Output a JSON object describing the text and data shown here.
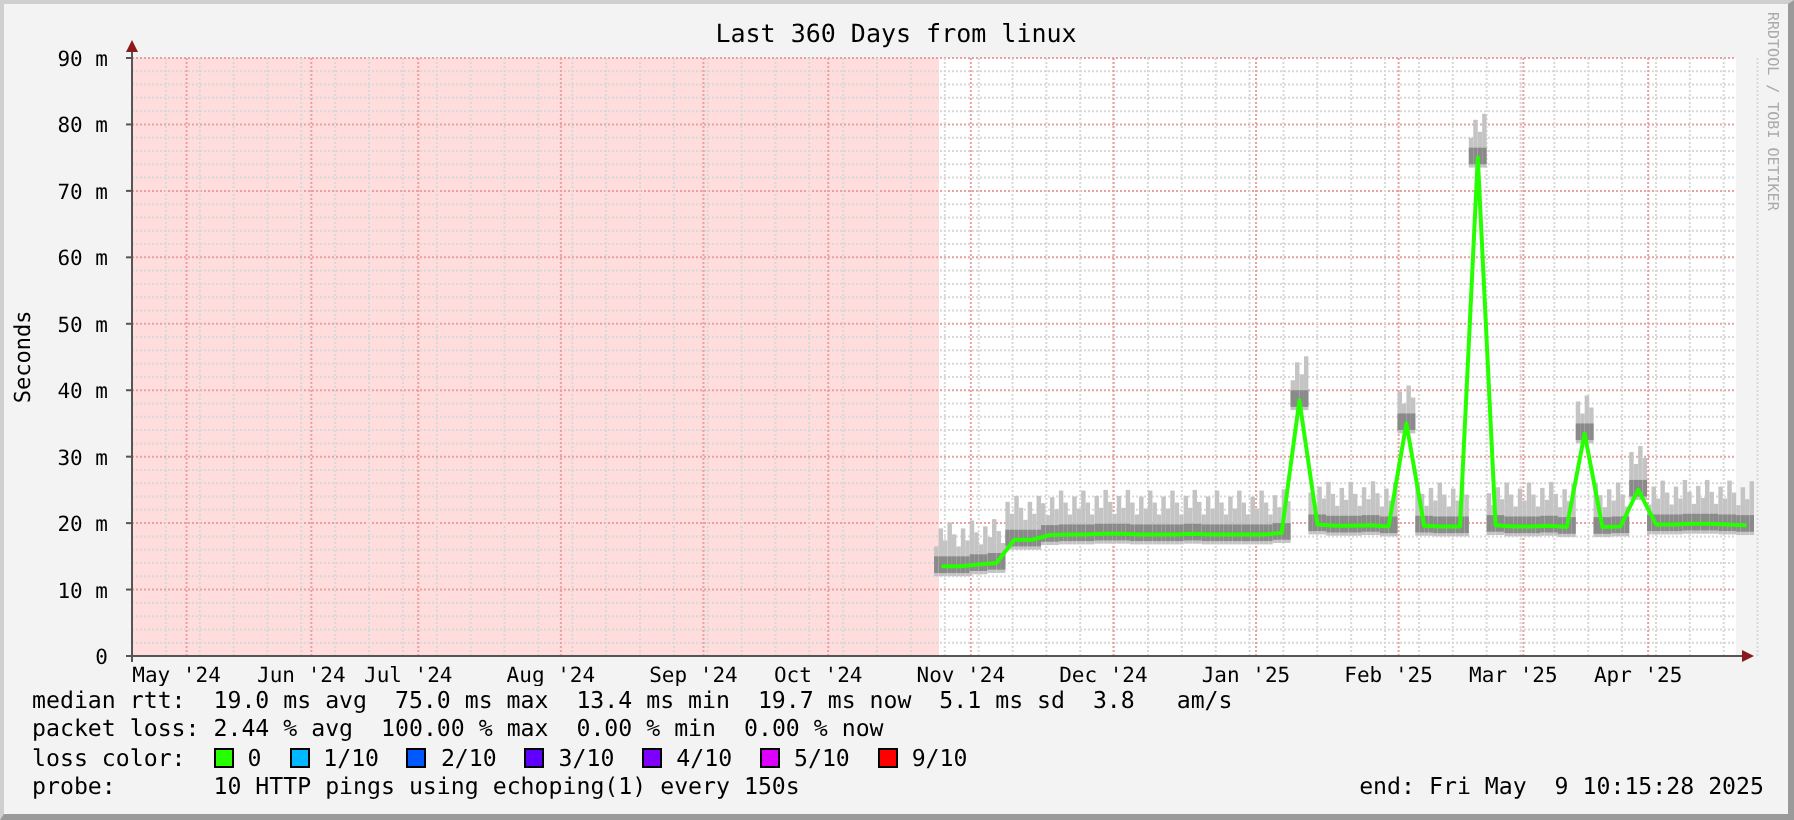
{
  "title": "Last 360 Days from linux",
  "side_text": "RRDTOOL / TOBI OETIKER",
  "chart_data": {
    "type": "line",
    "ylabel": "Seconds",
    "ylim": [
      0,
      90
    ],
    "grid": true,
    "categories": [
      null,
      null,
      "May '24",
      null,
      null,
      null,
      null,
      null,
      null,
      "Jun '24",
      null,
      null,
      null,
      null,
      null,
      "Jul '24",
      null,
      null,
      null,
      null,
      null,
      null,
      null,
      "Aug '24",
      null,
      null,
      null,
      null,
      null,
      null,
      null,
      "Sep '24",
      null,
      null,
      null,
      null,
      null,
      null,
      "Oct '24",
      null,
      null,
      null,
      null,
      null,
      null,
      null,
      "Nov '24",
      null,
      null,
      null,
      null,
      null,
      null,
      null,
      "Dec '24",
      null,
      null,
      null,
      null,
      null,
      null,
      null,
      "Jan '25",
      null,
      null,
      null,
      null,
      null,
      null,
      null,
      "Feb '25",
      null,
      null,
      null,
      null,
      null,
      null,
      "Mar '25",
      null,
      null,
      null,
      null,
      null,
      null,
      "Apr '25",
      null,
      null,
      null,
      null,
      null,
      null
    ],
    "yticks": [
      {
        "value": 0,
        "label": "0"
      },
      {
        "value": 10,
        "label": "10 m"
      },
      {
        "value": 20,
        "label": "20 m"
      },
      {
        "value": 30,
        "label": "30 m"
      },
      {
        "value": 40,
        "label": "40 m"
      },
      {
        "value": 50,
        "label": "50 m"
      },
      {
        "value": 60,
        "label": "60 m"
      },
      {
        "value": 70,
        "label": "70 m"
      },
      {
        "value": 80,
        "label": "80 m"
      },
      {
        "value": 90,
        "label": "90 m"
      }
    ],
    "series": [
      {
        "color": "#26ff00",
        "values": [
          null,
          null,
          null,
          null,
          null,
          null,
          null,
          null,
          null,
          null,
          null,
          null,
          null,
          null,
          null,
          null,
          null,
          null,
          null,
          null,
          null,
          null,
          null,
          null,
          null,
          null,
          null,
          null,
          null,
          null,
          null,
          null,
          null,
          null,
          null,
          null,
          null,
          null,
          null,
          null,
          null,
          null,
          null,
          null,
          null,
          13.5,
          13.5,
          13.8,
          14,
          17.5,
          17.5,
          18.2,
          18.3,
          18.3,
          18.4,
          18.4,
          18.3,
          18.3,
          18.3,
          18.4,
          18.3,
          18.3,
          18.3,
          18.3,
          18.5,
          38.5,
          19.8,
          19.6,
          19.6,
          19.7,
          19.5,
          35,
          19.6,
          19.5,
          19.5,
          75,
          19.7,
          19.5,
          19.5,
          19.6,
          19.4,
          33.5,
          19.4,
          19.5,
          25,
          19.8,
          19.8,
          19.9,
          19.9,
          19.8,
          19.7
        ]
      }
    ]
  },
  "legend": [
    {
      "label": "median rtt:",
      "items": [
        "19.0 ms avg",
        "75.0 ms max",
        "13.4 ms min",
        "19.7 ms now",
        "5.1 ms sd",
        "3.8   am/s"
      ]
    },
    {
      "label": "packet loss:",
      "items": [
        "2.44 % avg",
        "100.00 % max",
        "0.00 % min",
        "0.00 % now"
      ]
    }
  ],
  "loss_color": {
    "label": "loss color:",
    "items": [
      {
        "label": "0",
        "color": "#26ff00"
      },
      {
        "label": "1/10",
        "color": "#00b8ff"
      },
      {
        "label": "2/10",
        "color": "#0059ff"
      },
      {
        "label": "3/10",
        "color": "#5e00ff"
      },
      {
        "label": "4/10",
        "color": "#7e00ff"
      },
      {
        "label": "5/10",
        "color": "#dd00ff"
      },
      {
        "label": "9/10",
        "color": "#ff0000"
      }
    ]
  },
  "probe": {
    "label": "probe:",
    "value": "10 HTTP pings using echoping(1) every 150s"
  },
  "end": "end: Fri May  9 10:15:28 2025"
}
